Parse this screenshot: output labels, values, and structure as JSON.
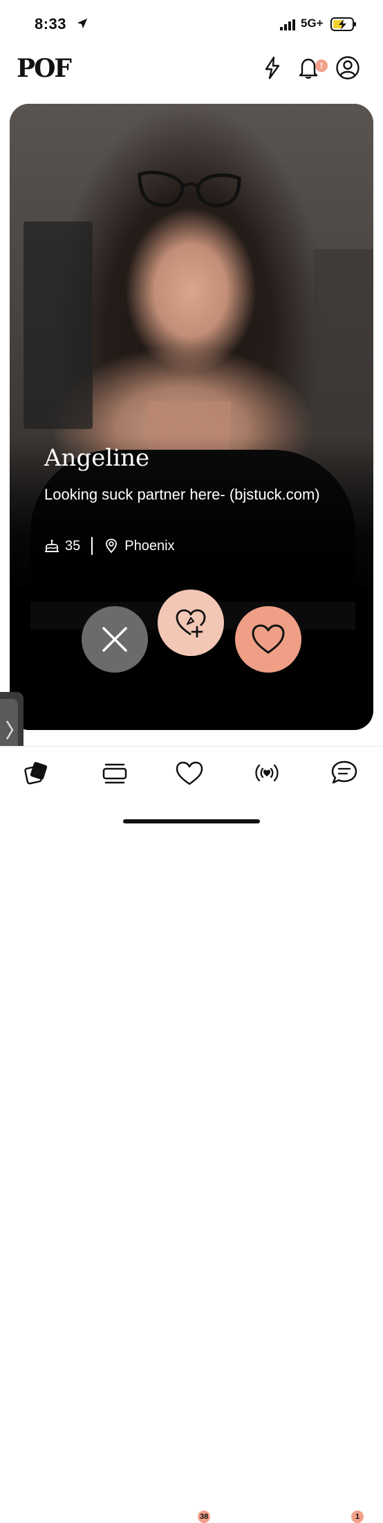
{
  "status_bar": {
    "time": "8:33",
    "network": "5G+"
  },
  "header": {
    "logo": "POF",
    "icons": [
      "bolt-icon",
      "bell-icon",
      "profile-icon"
    ],
    "notification_badge": "!"
  },
  "profile": {
    "name": "Angeline",
    "bio": "Looking suck partner here- (bjstuck.com)",
    "age": "35",
    "location": "Phoenix"
  },
  "actions": [
    {
      "name": "pass",
      "icon": "close-icon"
    },
    {
      "name": "superlike",
      "icon": "heart-plus-icon"
    },
    {
      "name": "like",
      "icon": "heart-icon"
    }
  ],
  "tabbar": {
    "likes_badge": "38",
    "chat_badge": "1"
  },
  "colors": {
    "accent": "#ee9f85",
    "accent_light": "#f3c7b6",
    "pass_button": "#6b6b6b",
    "badge": "#f2a08a",
    "card_bg": "#000000"
  }
}
